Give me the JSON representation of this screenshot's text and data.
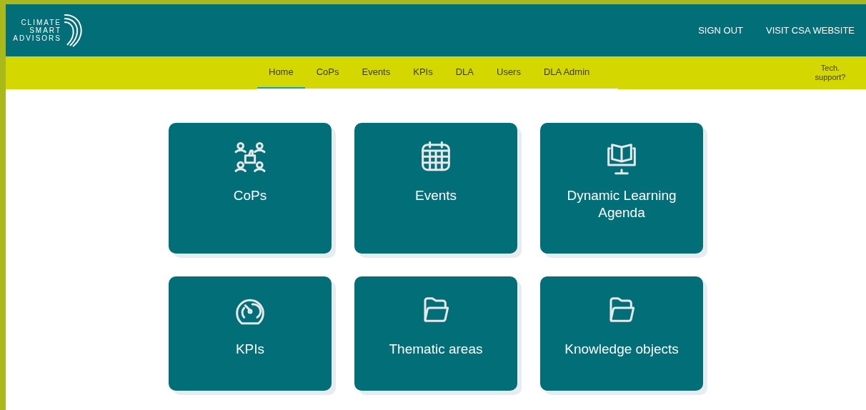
{
  "logo": {
    "lines": [
      "CLIMATE",
      "SMART",
      "ADVISORS"
    ]
  },
  "header_links": [
    "SIGN OUT",
    "VISIT CSA WEBSITE"
  ],
  "nav": [
    {
      "label": "Home",
      "selected": true
    },
    {
      "label": "CoPs",
      "selected": false
    },
    {
      "label": "Events",
      "selected": false
    },
    {
      "label": "KPIs",
      "selected": false
    },
    {
      "label": "DLA",
      "selected": false
    },
    {
      "label": "Users",
      "selected": false
    },
    {
      "label": "DLA Admin",
      "selected": false
    }
  ],
  "tech_support": "Tech. support?",
  "tiles": [
    {
      "label": "CoPs",
      "kind": "community"
    },
    {
      "label": "Events",
      "kind": "calendar"
    },
    {
      "label": "Dynamic Learning Agenda",
      "kind": "learning"
    },
    {
      "label": "KPIs",
      "kind": "gauge"
    },
    {
      "label": "Thematic areas",
      "kind": "folder"
    },
    {
      "label": "Knowledge objects",
      "kind": "folder"
    }
  ]
}
